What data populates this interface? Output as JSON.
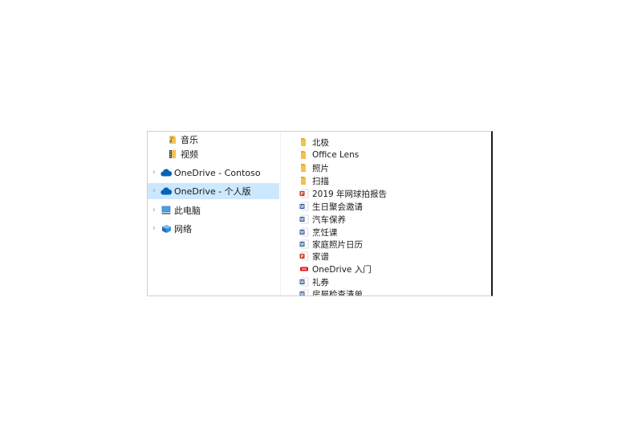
{
  "nav": {
    "items": [
      {
        "label": "音乐",
        "icon": "music-folder-icon",
        "indent": true
      },
      {
        "label": "视频",
        "icon": "video-folder-icon",
        "indent": true
      },
      {
        "label": "OneDrive - Contoso",
        "icon": "onedrive-cloud-icon",
        "expandable": true
      },
      {
        "label": "OneDrive - 个人版",
        "icon": "onedrive-cloud-icon",
        "expandable": true,
        "selected": true
      },
      {
        "label": "此电脑",
        "icon": "this-pc-icon",
        "expandable": true
      },
      {
        "label": "网络",
        "icon": "network-icon",
        "expandable": true
      }
    ]
  },
  "files": {
    "items": [
      {
        "name": "北极",
        "type": "folder"
      },
      {
        "name": "Office Lens",
        "type": "folder"
      },
      {
        "name": "照片",
        "type": "folder"
      },
      {
        "name": "扫描",
        "type": "folder"
      },
      {
        "name": "2019 年网球拍报告",
        "type": "powerpoint"
      },
      {
        "name": "生日聚会邀请",
        "type": "word"
      },
      {
        "name": "汽车保养",
        "type": "word"
      },
      {
        "name": "烹饪课",
        "type": "word"
      },
      {
        "name": "家庭照片日历",
        "type": "word"
      },
      {
        "name": "家谱",
        "type": "powerpoint"
      },
      {
        "name": "OneDrive 入门",
        "type": "pdf"
      },
      {
        "name": "礼券",
        "type": "word"
      },
      {
        "name": "房屋检查清单",
        "type": "word"
      }
    ]
  },
  "colors": {
    "selection": "#cce8ff",
    "folder": "#f4c04e",
    "onedrive": "#0364b8",
    "word": "#2b579a",
    "powerpoint": "#c43e1c",
    "pdf": "#e81123"
  }
}
